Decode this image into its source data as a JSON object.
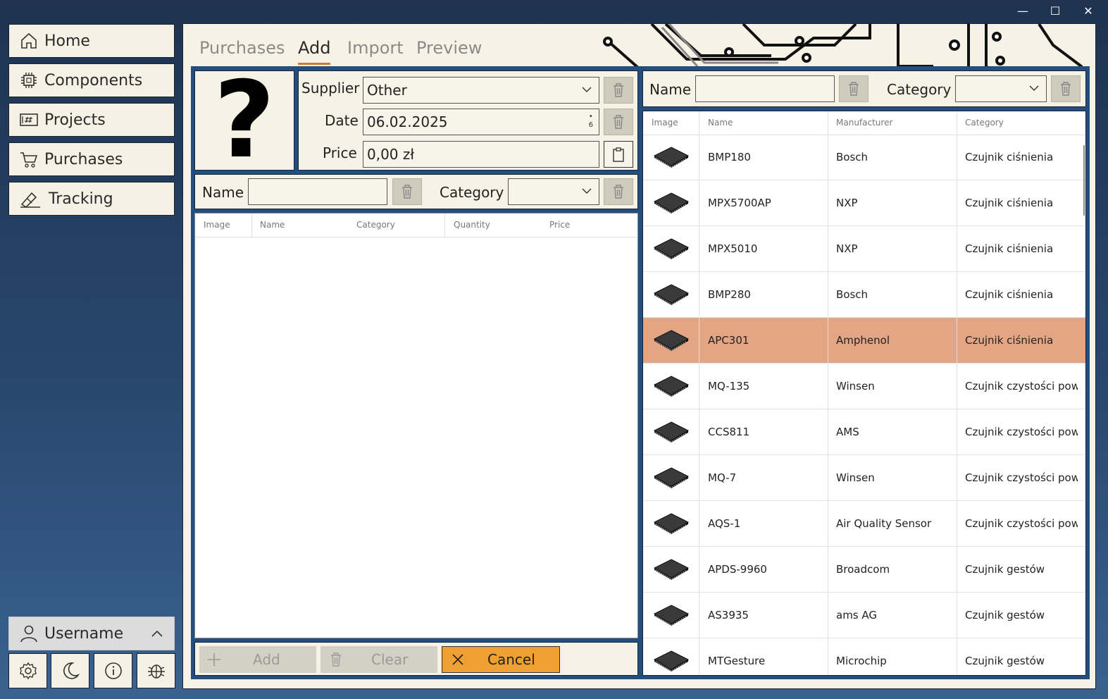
{
  "window_controls": {
    "minimize": "—",
    "maximize": "☐",
    "close": "✕"
  },
  "sidebar": {
    "items": [
      {
        "label": "Home",
        "icon": "home-icon"
      },
      {
        "label": "Components",
        "icon": "chip-icon"
      },
      {
        "label": "Projects",
        "icon": "grid-board-icon"
      },
      {
        "label": "Purchases",
        "icon": "cart-icon"
      },
      {
        "label": "Tracking",
        "icon": "tracking-icon"
      }
    ],
    "user": {
      "label": "Username"
    },
    "bottom_icons": [
      "gear-icon",
      "moon-icon",
      "info-icon",
      "bug-icon"
    ]
  },
  "tabs": [
    "Purchases",
    "Add",
    "Import",
    "Preview"
  ],
  "active_tab": "Add",
  "form": {
    "supplier_label": "Supplier",
    "supplier_value": "Other",
    "date_label": "Date",
    "date_value": "06.02.2025",
    "price_label": "Price",
    "price_value": "0,00 zł",
    "image_placeholder": "?"
  },
  "left_filter": {
    "name_label": "Name",
    "name_value": "",
    "category_label": "Category",
    "category_value": ""
  },
  "left_table": {
    "columns": [
      "Image",
      "Name",
      "Category",
      "Quantity",
      "Price"
    ],
    "rows": []
  },
  "bottom_buttons": {
    "add": "Add",
    "clear": "Clear",
    "cancel": "Cancel"
  },
  "right_filter": {
    "name_label": "Name",
    "name_value": "",
    "category_label": "Category",
    "category_value": ""
  },
  "right_table": {
    "columns": [
      "Image",
      "Name",
      "Manufacturer",
      "Category"
    ],
    "rows": [
      {
        "name": "BMP180",
        "manufacturer": "Bosch",
        "category": "Czujnik ciśnienia",
        "selected": false
      },
      {
        "name": "MPX5700AP",
        "manufacturer": "NXP",
        "category": "Czujnik ciśnienia",
        "selected": false
      },
      {
        "name": "MPX5010",
        "manufacturer": "NXP",
        "category": "Czujnik ciśnienia",
        "selected": false
      },
      {
        "name": "BMP280",
        "manufacturer": "Bosch",
        "category": "Czujnik ciśnienia",
        "selected": false
      },
      {
        "name": "APC301",
        "manufacturer": "Amphenol",
        "category": "Czujnik ciśnienia",
        "selected": true
      },
      {
        "name": "MQ-135",
        "manufacturer": "Winsen",
        "category": "Czujnik czystości powi",
        "selected": false
      },
      {
        "name": "CCS811",
        "manufacturer": "AMS",
        "category": "Czujnik czystości powi",
        "selected": false
      },
      {
        "name": "MQ-7",
        "manufacturer": "Winsen",
        "category": "Czujnik czystości powi",
        "selected": false
      },
      {
        "name": "AQS-1",
        "manufacturer": "Air Quality Sensor",
        "category": "Czujnik czystości powi",
        "selected": false
      },
      {
        "name": "APDS-9960",
        "manufacturer": "Broadcom",
        "category": "Czujnik gestów",
        "selected": false
      },
      {
        "name": "AS3935",
        "manufacturer": "ams AG",
        "category": "Czujnik gestów",
        "selected": false
      },
      {
        "name": "MTGesture",
        "manufacturer": "Microchip",
        "category": "Czujnik gestów",
        "selected": false
      }
    ]
  },
  "colors": {
    "accent": "#234e80",
    "selection": "#e3a583",
    "cancel": "#f0a030",
    "panel_bg": "#f6f3e6"
  }
}
